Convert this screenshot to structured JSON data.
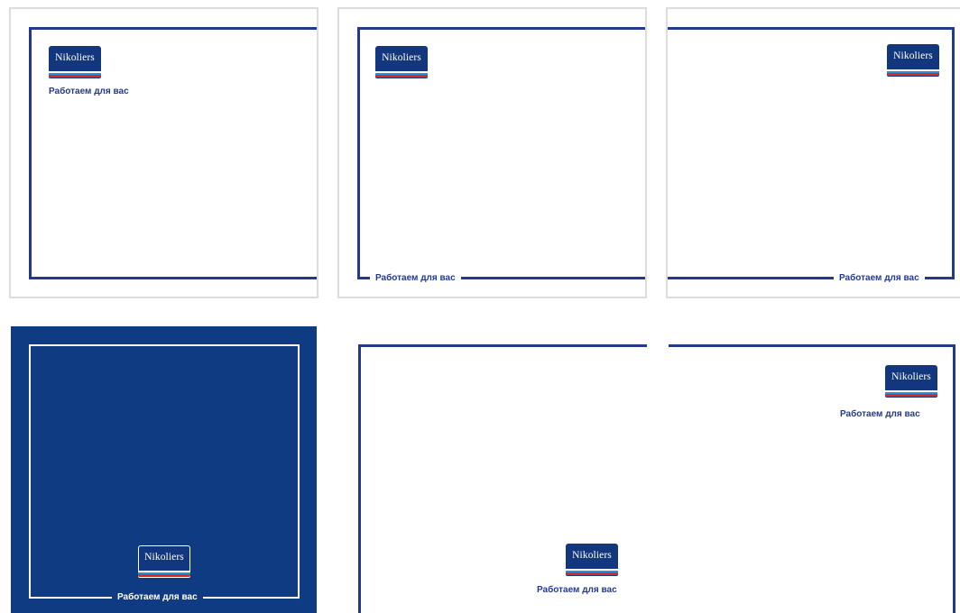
{
  "brand": {
    "logo_text": "Nikoliers",
    "tagline": "Работаем для вас",
    "colors": {
      "navy": "#233a8a",
      "card_dark": "#0f3b82",
      "stripe_blue": "#2a8fd6",
      "stripe_red": "#d72b24",
      "card_border": "#dcdcdc"
    }
  },
  "cards": [
    {
      "logo_text": "Nikoliers",
      "tagline": "Работаем для вас"
    },
    {
      "logo_text": "Nikoliers",
      "tagline": "Работаем для вас"
    },
    {
      "logo_text": "Nikoliers",
      "tagline": "Работаем для вас"
    },
    {
      "logo_text": "Nikoliers",
      "tagline": "Работаем для вас"
    },
    {
      "logo_text": "Nikoliers",
      "tagline": "Работаем для вас"
    },
    {
      "logo_text": "Nikoliers",
      "tagline": "Работаем для вас"
    }
  ]
}
